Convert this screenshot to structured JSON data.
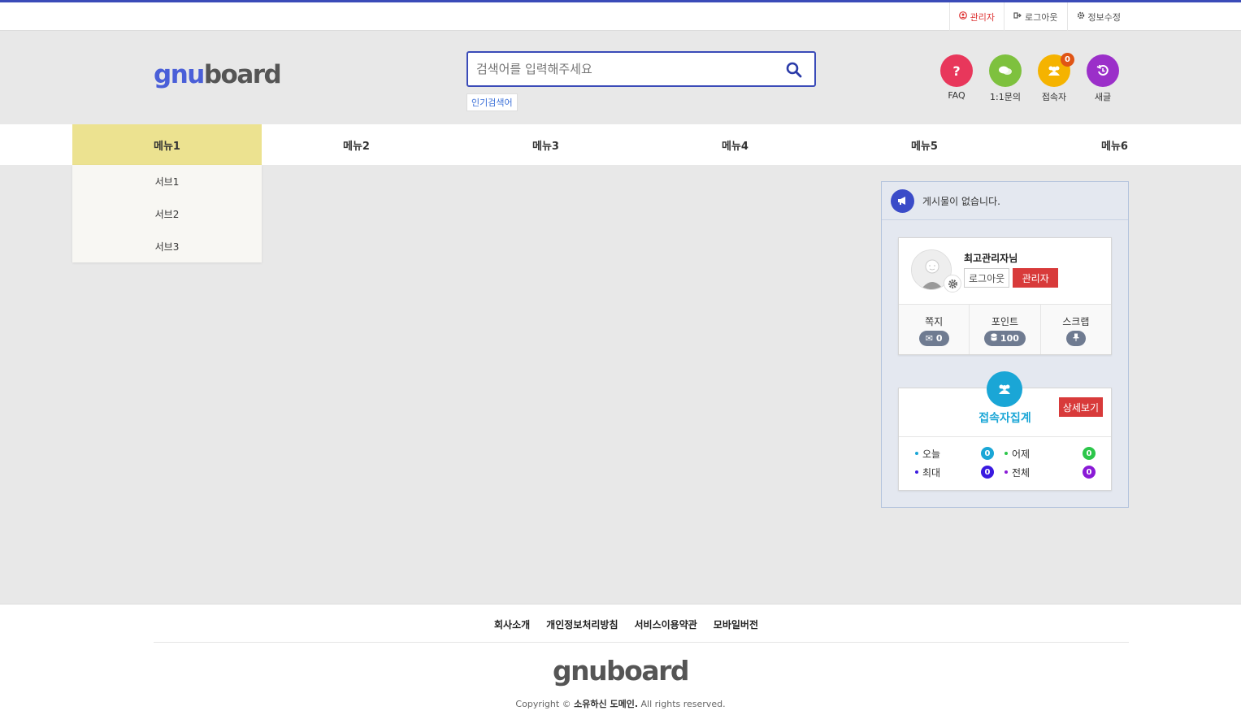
{
  "topbar": {
    "links": [
      {
        "label": "관리자",
        "icon": "user-circle-icon"
      },
      {
        "label": "로그아웃",
        "icon": "sign-out-icon"
      },
      {
        "label": "정보수정",
        "icon": "gear-icon"
      }
    ]
  },
  "header": {
    "logo_part1": "gnu",
    "logo_part2": "board",
    "search_placeholder": "검색어를 입력해주세요",
    "popular_label": "인기검색어",
    "quick": [
      {
        "label": "FAQ",
        "glyph": "?",
        "color": "#e8375b"
      },
      {
        "label": "1:1문의",
        "glyph": "💬",
        "color": "#7ec13e"
      },
      {
        "label": "접속자",
        "glyph": "👥",
        "color": "#f5b300",
        "count": "0"
      },
      {
        "label": "새글",
        "glyph": "↺",
        "color": "#9b2fc9"
      }
    ]
  },
  "nav": {
    "items": [
      "메뉴1",
      "메뉴2",
      "메뉴3",
      "메뉴4",
      "메뉴5",
      "메뉴6"
    ],
    "submenu": [
      "서브1",
      "서브2",
      "서브3"
    ]
  },
  "panel": {
    "notice": "게시물이 없습니다.",
    "user": {
      "name": "최고관리자님",
      "logout": "로그아웃",
      "admin": "관리자",
      "stats": [
        {
          "label": "쪽지",
          "value": "0",
          "icon": "envelope-icon"
        },
        {
          "label": "포인트",
          "value": "100",
          "icon": "database-icon"
        },
        {
          "label": "스크랩",
          "value": "",
          "icon": "pin-icon"
        }
      ]
    },
    "visit": {
      "title": "접속자집계",
      "detail": "상세보기",
      "rows": [
        [
          {
            "label": "오늘",
            "value": "0",
            "color": "#1aa6d6"
          },
          {
            "label": "어제",
            "value": "0",
            "color": "#2cc64a"
          }
        ],
        [
          {
            "label": "최대",
            "value": "0",
            "color": "#3a1ae0"
          },
          {
            "label": "전체",
            "value": "0",
            "color": "#8a1ad6"
          }
        ]
      ]
    }
  },
  "footer": {
    "links": [
      "회사소개",
      "개인정보처리방침",
      "서비스이용약관",
      "모바일버전"
    ],
    "logo": "gnuboard",
    "copyright_prefix": "Copyright © ",
    "domain": "소유하신 도메인.",
    "copyright_suffix": " All rights reserved."
  }
}
